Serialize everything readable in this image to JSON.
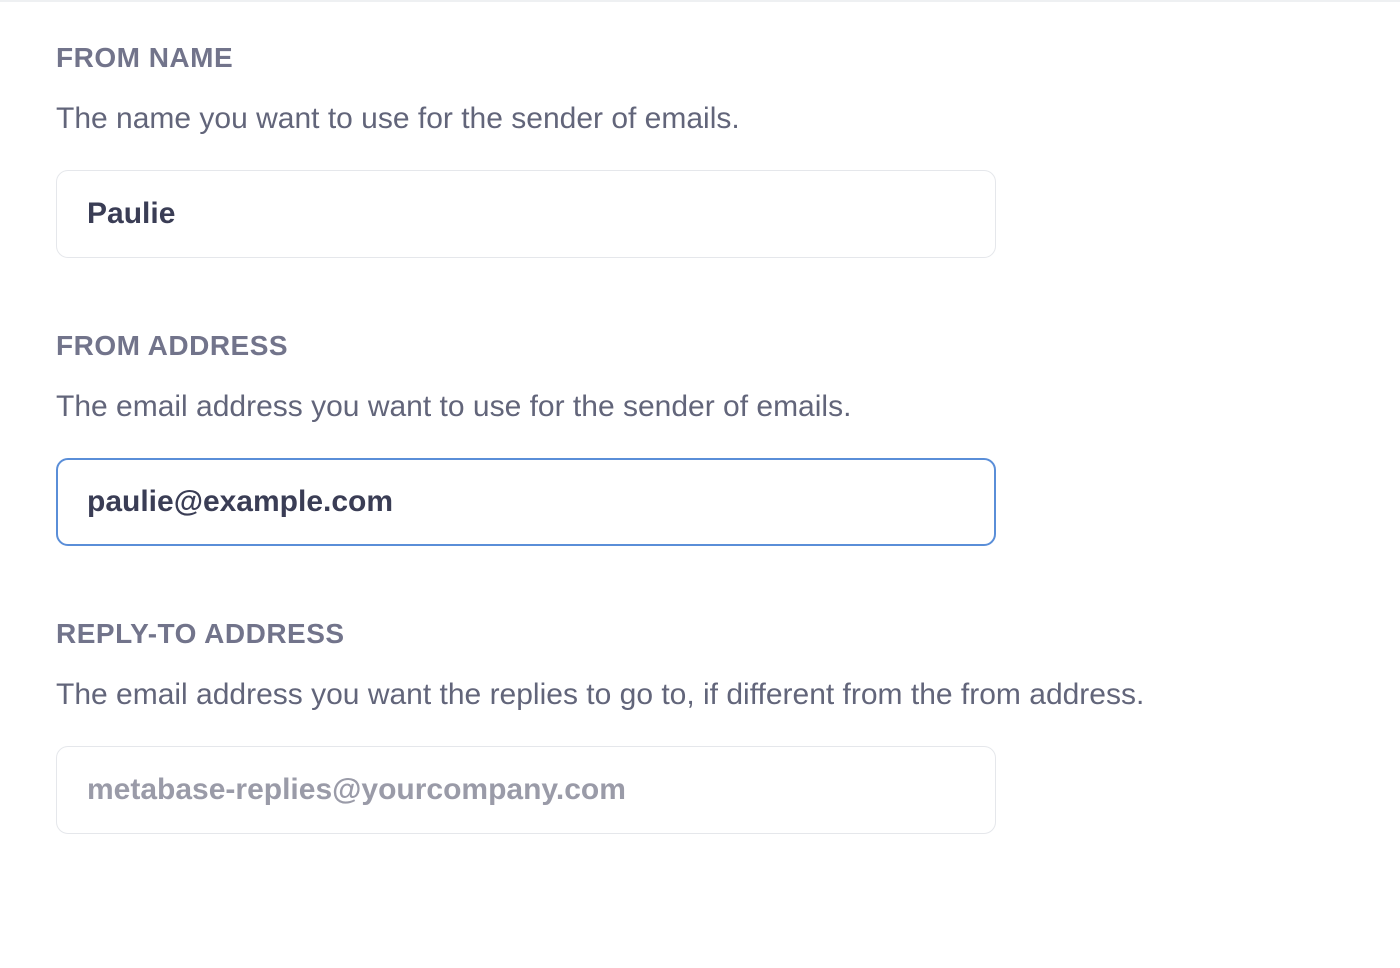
{
  "fields": {
    "fromName": {
      "label": "FROM NAME",
      "description": "The name you want to use for the sender of emails.",
      "value": "Paulie",
      "placeholder": ""
    },
    "fromAddress": {
      "label": "FROM ADDRESS",
      "description": "The email address you want to use for the sender of emails.",
      "value": "paulie@example.com",
      "placeholder": ""
    },
    "replyToAddress": {
      "label": "REPLY-TO ADDRESS",
      "description": "The email address you want the replies to go to, if different from the from address.",
      "value": "",
      "placeholder": "metabase-replies@yourcompany.com"
    }
  }
}
